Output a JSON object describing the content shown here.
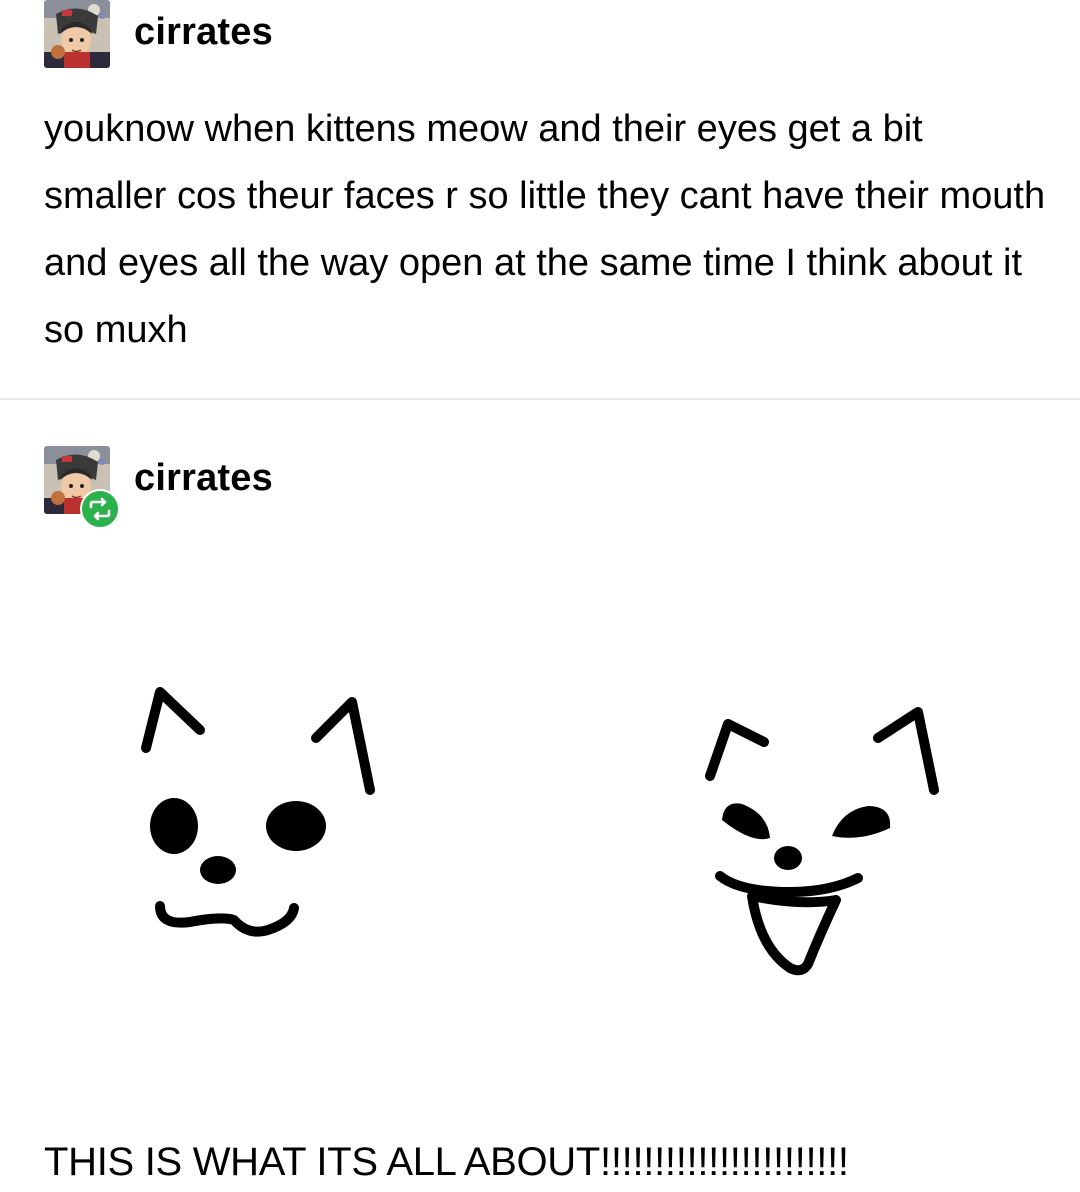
{
  "post1": {
    "username": "cirrates",
    "avatar_icon": "anime-character-avatar-icon",
    "body": "youknow when kittens meow and their eyes get a bit smaller cos theur faces r so little they cant have their mouth and eyes all the way open at the same time I think about it so muxh"
  },
  "post2": {
    "username": "cirrates",
    "avatar_icon": "anime-character-avatar-icon",
    "reblog_icon": "reblog-icon",
    "reblog_color": "#2bb24c",
    "caption": "THIS IS WHAT ITS ALL ABOUT!!!!!!!!!!!!!!!!!!!!!!!"
  },
  "colors": {
    "background": "#ffffff",
    "text": "#000000",
    "divider": "#e9e9e9"
  }
}
